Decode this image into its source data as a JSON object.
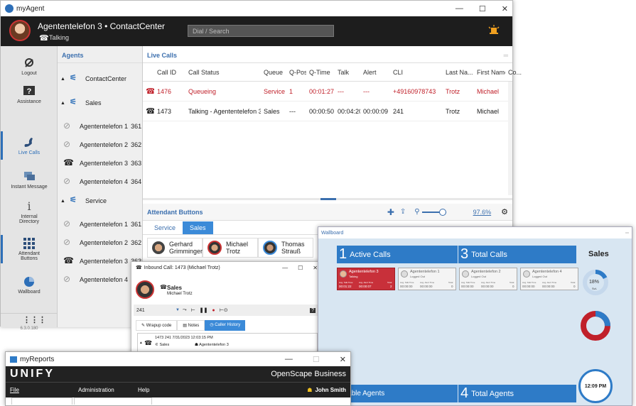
{
  "myagent": {
    "title": "myAgent",
    "header": {
      "agent_name": "Agententelefon 3 • ContactCenter",
      "status": "Talking",
      "dial_placeholder": "Dial / Search"
    },
    "left_nav": [
      {
        "label": "Logout",
        "icon": "logout-icon"
      },
      {
        "label": "Assistance",
        "icon": "assistance-icon"
      },
      {
        "label": "Live Calls",
        "icon": "phone-icon"
      },
      {
        "label": "Instant Message",
        "icon": "chat-icon"
      },
      {
        "label": "Internal Directory",
        "icon": "info-icon"
      },
      {
        "label": "Attendant Buttons",
        "icon": "grid-icon"
      },
      {
        "label": "Wallboard",
        "icon": "pie-icon"
      },
      {
        "label": "6.3.0.180",
        "icon": "more-icon"
      }
    ],
    "agents_title": "Agents",
    "groups": [
      {
        "name": "ContactCenter"
      },
      {
        "name": "Sales",
        "agents": [
          {
            "name": "Agententelefon 1",
            "ext": "361"
          },
          {
            "name": "Agententelefon 2",
            "ext": "362"
          },
          {
            "name": "Agententelefon 3",
            "ext": "363"
          },
          {
            "name": "Agententelefon 4",
            "ext": "364"
          }
        ]
      },
      {
        "name": "Service",
        "agents": [
          {
            "name": "Agententelefon 1",
            "ext": "361"
          },
          {
            "name": "Agententelefon 2",
            "ext": "362"
          },
          {
            "name": "Agententelefon 3",
            "ext": "363"
          },
          {
            "name": "Agententelefon 4",
            "ext": "36"
          }
        ]
      }
    ],
    "live_calls": {
      "title": "Live Calls",
      "columns": [
        "Call ID",
        "Call Status",
        "Queue",
        "Q-Pos",
        "Q-Time",
        "Talk",
        "Alert",
        "CLI",
        "Last Na...",
        "First Name",
        "Co..."
      ],
      "rows": [
        [
          "1476",
          "Queueing",
          "Service",
          "1",
          "00:01:27",
          "---",
          "---",
          "+49160978743",
          "Trotz",
          "Michael",
          ""
        ],
        [
          "1473",
          "Talking - Agententelefon 3",
          "Sales",
          "---",
          "00:00:50",
          "00:04:20",
          "00:00:09",
          "241",
          "Trotz",
          "Michael",
          ""
        ]
      ]
    },
    "attendant": {
      "title": "Attendant Buttons",
      "zoom": "97.6%",
      "tabs": [
        "Service",
        "Sales"
      ],
      "contacts": [
        "Gerhard Grimminger",
        "Michael Trotz",
        "Thomas Strauß"
      ]
    }
  },
  "inbound": {
    "title": "Inbound Call: 1473 (Michael Trotz)",
    "queue": "Sales",
    "caller": "Michael Trotz",
    "number": "241",
    "tabs": [
      "Wrapup code",
      "Notes",
      "Caller History"
    ],
    "history": {
      "id": "1473",
      "number": "241",
      "datetime": "7/31/2023 12:03:15 PM",
      "group": "Sales",
      "agent": "Agententelefon 3"
    }
  },
  "wallboard": {
    "title": "Wallboard",
    "active_calls": {
      "count": "1",
      "label": "Active Calls"
    },
    "total_calls": {
      "count": "3",
      "label": "Total Calls"
    },
    "queue": "Sales",
    "agents": [
      {
        "name": "Agententelefon 3",
        "status": "Talking",
        "v1": "00:01:22",
        "v2": "00:00:07",
        "v3": "2"
      },
      {
        "name": "Agententelefon 1",
        "status": "Logged Out",
        "v1": "00:00:00",
        "v2": "00:00:00",
        "v3": "0"
      },
      {
        "name": "Agententelefon 2",
        "status": "Logged Out",
        "v1": "00:00:00",
        "v2": "00:00:00",
        "v3": "0"
      },
      {
        "name": "Agententelefon 4",
        "status": "Logged Out",
        "v1": "00:00:00",
        "v2": "00:00:00",
        "v3": "0"
      }
    ],
    "col_labels": [
      "Avg. Talk Time",
      "Avg. Alert Time",
      "Total"
    ],
    "percent": "18%",
    "percent_label": "SvL",
    "available_agents": "vailable Agents",
    "total_agents": {
      "count": "4",
      "label": "Total Agents"
    },
    "clock": "12:09 PM"
  },
  "myreports": {
    "title": "myReports",
    "brand": "UNIFY",
    "product": "OpenScape Business",
    "menu": [
      "File",
      "Administration",
      "Help"
    ],
    "user": "John Smith"
  },
  "colors": {
    "accent": "#3b6fae",
    "alert": "#c0202a",
    "wallboard_blue": "#2e7bc7",
    "header_dark": "#1d1d1d"
  }
}
